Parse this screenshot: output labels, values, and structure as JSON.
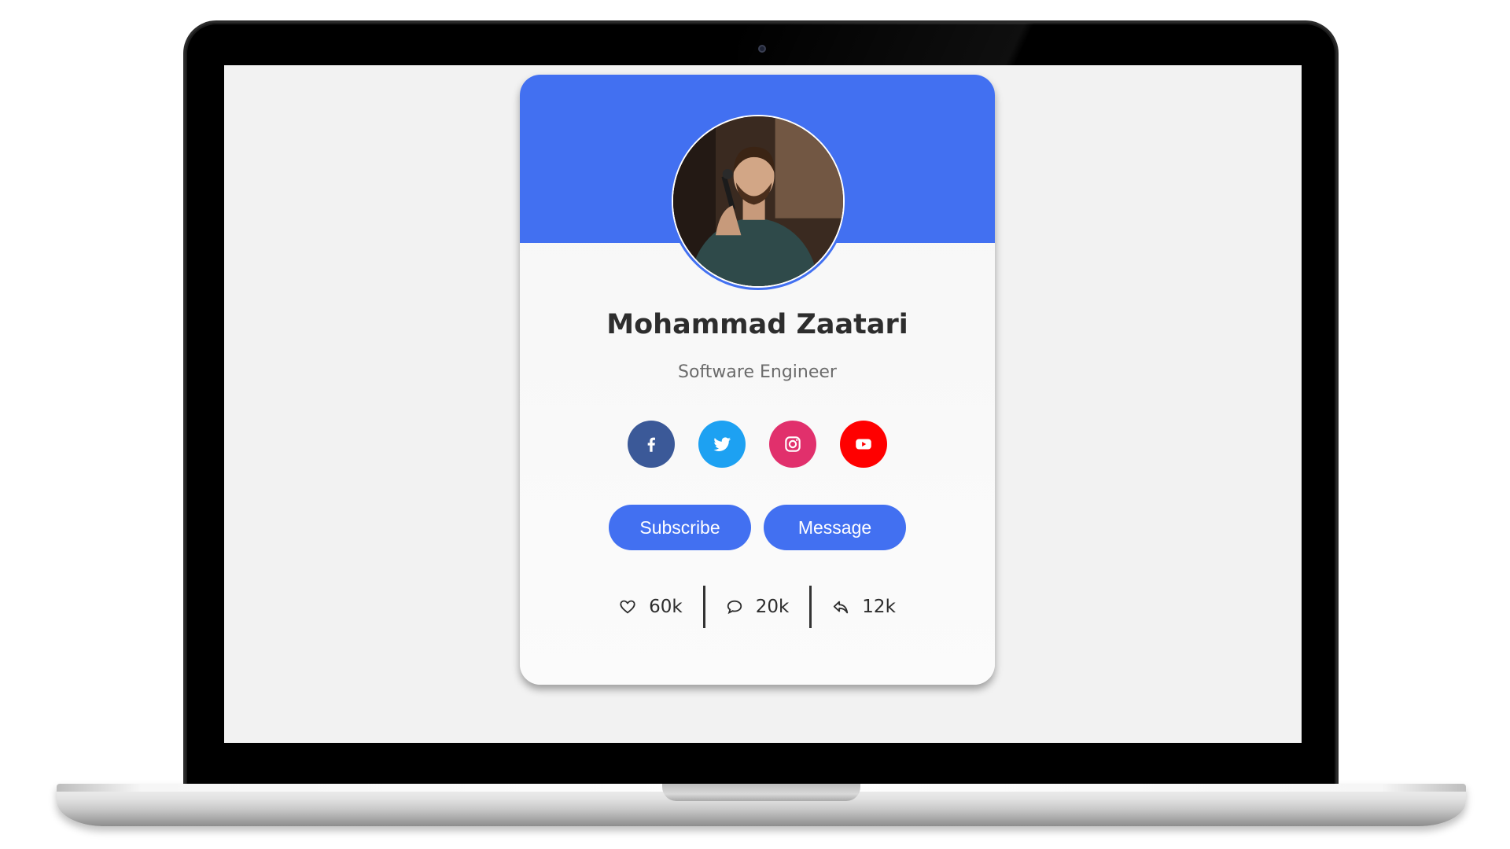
{
  "profile": {
    "name": "Mohammad Zaatari",
    "role": "Software Engineer"
  },
  "socials": [
    {
      "name": "facebook",
      "icon": "facebook-icon",
      "color": "#3b5998"
    },
    {
      "name": "twitter",
      "icon": "twitter-icon",
      "color": "#1da1f2"
    },
    {
      "name": "instagram",
      "icon": "instagram-icon",
      "color": "#e1306c"
    },
    {
      "name": "youtube",
      "icon": "youtube-icon",
      "color": "#ff0000"
    }
  ],
  "actions": {
    "subscribe_label": "Subscribe",
    "message_label": "Message"
  },
  "stats": {
    "likes": "60k",
    "comments": "20k",
    "shares": "12k"
  },
  "colors": {
    "accent": "#4270f1",
    "screen_bg": "#f2f2f2"
  }
}
